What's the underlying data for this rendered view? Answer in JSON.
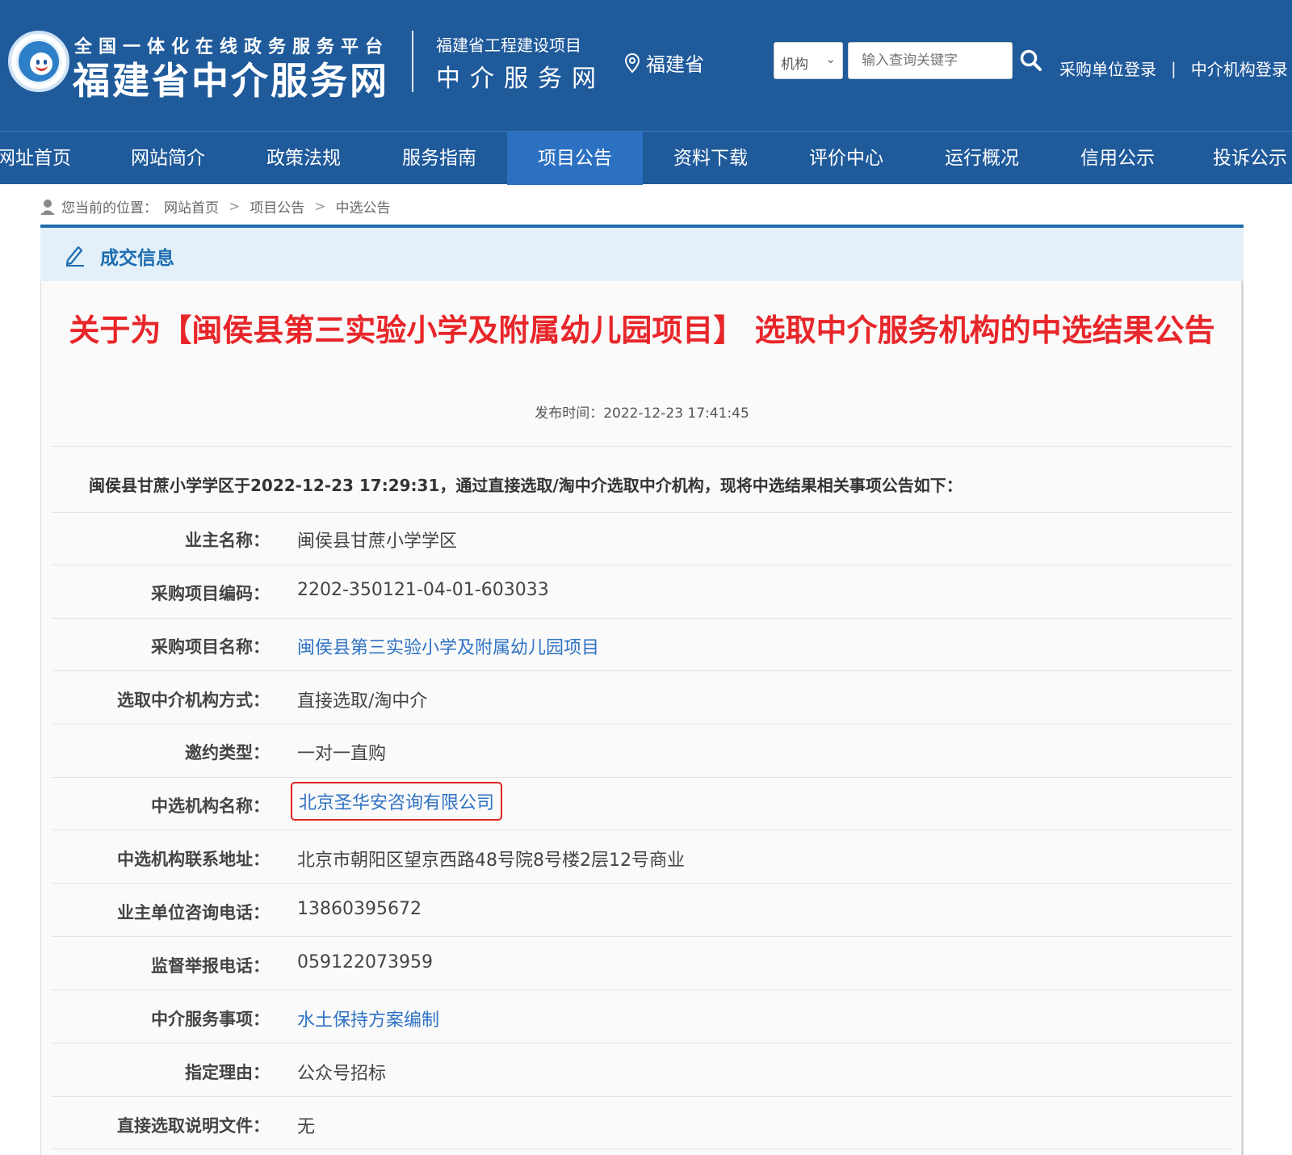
{
  "header": {
    "platform_subtitle": "全国一体化在线政务服务平台",
    "site_name": "福建省中介服务网",
    "project_line1": "福建省工程建设项目",
    "project_line2": "中介服务网",
    "region": "福建省",
    "search": {
      "select_value": "机构",
      "placeholder": "输入查询关键字"
    },
    "login_buyer": "采购单位登录",
    "login_separator": "|",
    "login_agency": "中介机构登录"
  },
  "nav": {
    "items": [
      {
        "label": "网址首页"
      },
      {
        "label": "网站简介"
      },
      {
        "label": "政策法规"
      },
      {
        "label": "服务指南"
      },
      {
        "label": "项目公告",
        "active": true
      },
      {
        "label": "资料下载"
      },
      {
        "label": "评价中心"
      },
      {
        "label": "运行概况"
      },
      {
        "label": "信用公示"
      },
      {
        "label": "投诉公示"
      }
    ]
  },
  "breadcrumb": {
    "prefix": "您当前的位置：",
    "items": [
      "网站首页",
      "项目公告",
      "中选公告"
    ],
    "separator": ">"
  },
  "panel": {
    "title": "成交信息"
  },
  "notice": {
    "title": "关于为【闽侯县第三实验小学及附属幼儿园项目】 选取中介服务机构的中选结果公告",
    "publish_time": "发布时间：2022-12-23 17:41:45",
    "intro": "闽侯县甘蔗小学学区于2022-12-23 17:29:31，通过直接选取/淘中介选取中介机构，现将中选结果相关事项公告如下：",
    "rows": [
      {
        "label": "业主名称：",
        "value": "闽侯县甘蔗小学学区"
      },
      {
        "label": "采购项目编码：",
        "value": "2202-350121-04-01-603033"
      },
      {
        "label": "采购项目名称：",
        "value": "闽侯县第三实验小学及附属幼儿园项目"
      },
      {
        "label": "选取中介机构方式：",
        "value": "直接选取/淘中介"
      },
      {
        "label": "邀约类型：",
        "value": "一对一直购"
      },
      {
        "label": "中选机构名称：",
        "value": "北京圣华安咨询有限公司"
      },
      {
        "label": "中选机构联系地址：",
        "value": "北京市朝阳区望京西路48号院8号楼2层12号商业"
      },
      {
        "label": "业主单位咨询电话：",
        "value": "13860395672"
      },
      {
        "label": "监督举报电话：",
        "value": "059122073959"
      },
      {
        "label": "中介服务事项：",
        "value": "水土保持方案编制"
      },
      {
        "label": "指定理由：",
        "value": "公众号招标"
      },
      {
        "label": "直接选取说明文件：",
        "value": "无"
      }
    ]
  },
  "colors": {
    "header_bg": "#1f5a9b",
    "nav_active_bg": "#2c70c1",
    "title_red": "#e8262a",
    "link_blue": "#2f72c4",
    "highlight_box": "#e02323"
  }
}
